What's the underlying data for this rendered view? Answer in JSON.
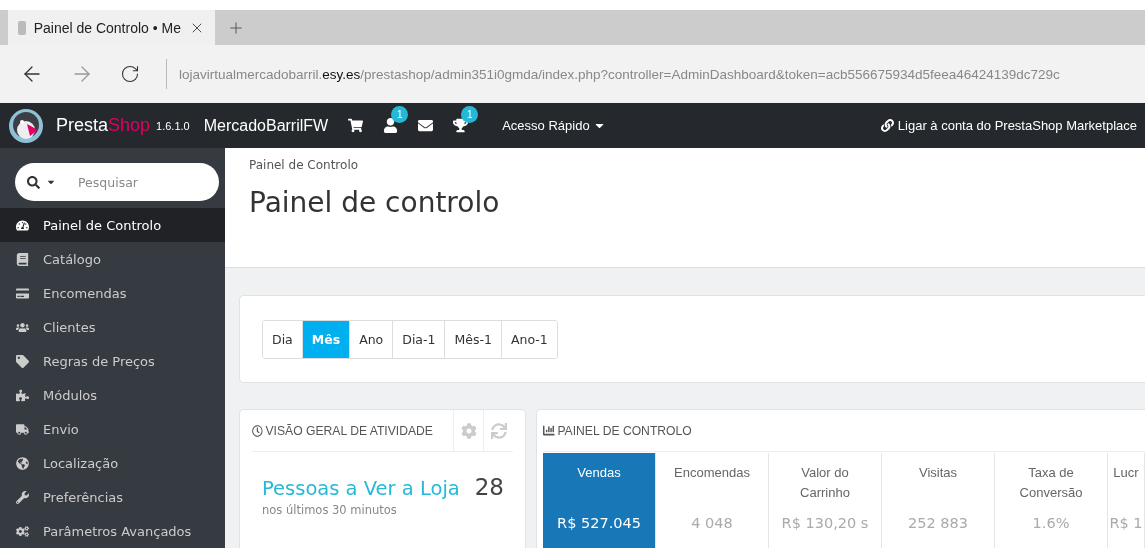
{
  "browser": {
    "tab_title": "Painel de Controlo • Me",
    "url_parts": [
      {
        "text": "lojavirtualmercadobarril.",
        "emphasis": false
      },
      {
        "text": "esy.es",
        "emphasis": true
      },
      {
        "text": "/prestashop/admin351i0gmda/index.php?controller=AdminDashboard&token=acb556675934d5feea46424139dc729c",
        "emphasis": false
      }
    ]
  },
  "topbar": {
    "brand_a": "Presta",
    "brand_b": "Shop",
    "version": "1.6.1.0",
    "shop_name": "MercadoBarrilFW",
    "icons": [
      {
        "kind": "cart"
      },
      {
        "kind": "user",
        "badge": "1"
      },
      {
        "kind": "mail"
      },
      {
        "kind": "trophy",
        "badge": "1"
      }
    ],
    "quick_access": "Acesso Rápido",
    "marketplace": "Ligar à conta do PrestaShop Marketplace"
  },
  "sidebar": {
    "search_placeholder": "Pesquisar",
    "items": [
      {
        "label": "Painel de Controlo",
        "kind": "dashboard",
        "selected": true
      },
      {
        "label": "Catálogo",
        "kind": "book",
        "selected": false
      },
      {
        "label": "Encomendas",
        "kind": "card",
        "selected": false
      },
      {
        "label": "Clientes",
        "kind": "users",
        "selected": false
      },
      {
        "label": "Regras de Preços",
        "kind": "tag",
        "selected": false
      },
      {
        "label": "Módulos",
        "kind": "puzzle",
        "selected": false
      },
      {
        "label": "Envio",
        "kind": "truck",
        "selected": false
      },
      {
        "label": "Localização",
        "kind": "globe",
        "selected": false
      },
      {
        "label": "Preferências",
        "kind": "wrench",
        "selected": false
      },
      {
        "label": "Parâmetros Avançados",
        "kind": "cogs",
        "selected": false
      }
    ]
  },
  "breadcrumb": "Painel de Controlo",
  "page_title": "Painel de controlo",
  "periods": [
    {
      "label": "Dia",
      "selected": false
    },
    {
      "label": "Mês",
      "selected": true
    },
    {
      "label": "Ano",
      "selected": false
    },
    {
      "label": "Dia-1",
      "selected": false
    },
    {
      "label": "Mês-1",
      "selected": false
    },
    {
      "label": "Ano-1",
      "selected": false
    }
  ],
  "activity": {
    "title": "VISÃO GERAL DE ATIVIDADE",
    "stat_label": "Pessoas a Ver a Loja",
    "stat_value": "28",
    "stat_note": "nos últimos 30 minutos"
  },
  "dashboard": {
    "title": "PAINEL DE CONTROLO",
    "kpis": [
      {
        "label": "Vendas",
        "value": "R$ 527.045",
        "selected": true
      },
      {
        "label": "Encomendas",
        "value": "4 048",
        "selected": false
      },
      {
        "label": "Valor do Carrinho",
        "value": "R$ 130,20 s",
        "selected": false
      },
      {
        "label": "Visitas",
        "value": "252 883",
        "selected": false
      },
      {
        "label": "Taxa de Conversão",
        "value": "1.6%",
        "selected": false
      },
      {
        "label": "Lucr",
        "value": "R$ 1",
        "selected": false
      }
    ]
  }
}
